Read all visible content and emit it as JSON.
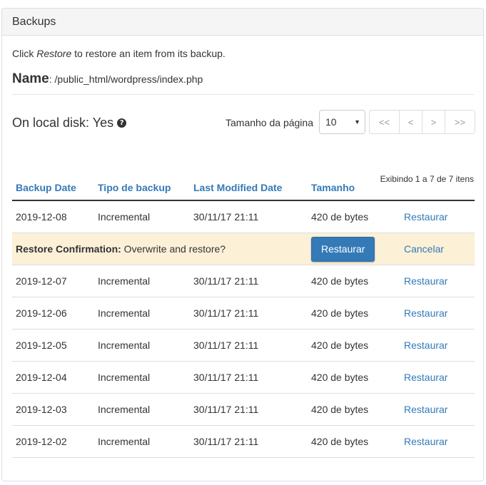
{
  "panel": {
    "title": "Backups"
  },
  "intro": {
    "before": "Click ",
    "em": "Restore",
    "after": " to restore an item from its backup."
  },
  "file": {
    "label": "Name",
    "colon": ":",
    "path": " /public_html/wordpress/index.php"
  },
  "local_disk": {
    "label": "On local disk: Yes",
    "icon": "question-circle-icon"
  },
  "pager": {
    "label": "Tamanho da página",
    "page_size": "10",
    "first": "<<",
    "prev": "<",
    "next": ">",
    "last": ">>",
    "showing": "Exibindo 1 a 7 de 7 itens"
  },
  "table": {
    "headers": [
      "Backup Date",
      "Tipo de backup",
      "Last Modified Date",
      "Tamanho"
    ],
    "action_label": "Restaurar",
    "confirm": {
      "label": "Restore Confirmation:",
      "text": " Overwrite and restore?",
      "button": "Restaurar",
      "cancel": "Cancelar"
    },
    "rows": [
      {
        "date": "2019-12-08",
        "type": "Incremental",
        "modified": "30/11/17 21:11",
        "size": "420 de bytes"
      },
      {
        "date": "2019-12-07",
        "type": "Incremental",
        "modified": "30/11/17 21:11",
        "size": "420 de bytes"
      },
      {
        "date": "2019-12-06",
        "type": "Incremental",
        "modified": "30/11/17 21:11",
        "size": "420 de bytes"
      },
      {
        "date": "2019-12-05",
        "type": "Incremental",
        "modified": "30/11/17 21:11",
        "size": "420 de bytes"
      },
      {
        "date": "2019-12-04",
        "type": "Incremental",
        "modified": "30/11/17 21:11",
        "size": "420 de bytes"
      },
      {
        "date": "2019-12-03",
        "type": "Incremental",
        "modified": "30/11/17 21:11",
        "size": "420 de bytes"
      },
      {
        "date": "2019-12-02",
        "type": "Incremental",
        "modified": "30/11/17 21:11",
        "size": "420 de bytes"
      }
    ]
  },
  "colors": {
    "link": "#337ab7",
    "confirm_bg": "#fcf0d7",
    "button": "#337ab7"
  }
}
